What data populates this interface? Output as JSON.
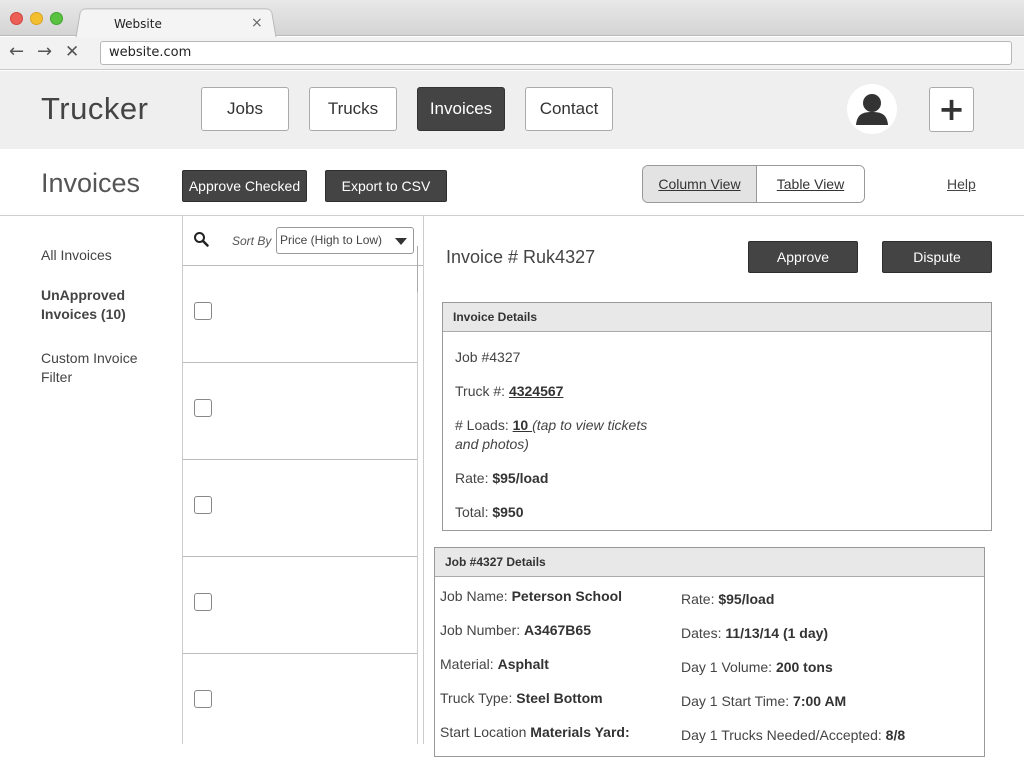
{
  "browser": {
    "tab_title": "Website",
    "tab_close": "×",
    "url": "website.com",
    "back_icon": "←",
    "forward_icon": "→",
    "stop_icon": "✕"
  },
  "app": {
    "logo": "Trucker",
    "nav": [
      "Jobs",
      "Trucks",
      "Invoices",
      "Contact"
    ],
    "active_nav": "Invoices",
    "plus": "+"
  },
  "toolbar": {
    "title": "Invoices",
    "approve_checked": "Approve Checked",
    "export_csv": "Export to CSV",
    "column_view": "Column View",
    "table_view": "Table View",
    "help": "Help"
  },
  "sidebar": {
    "items": [
      "All Invoices",
      "UnApproved Invoices (10)",
      "Custom Invoice Filter"
    ]
  },
  "list": {
    "sort_label": "Sort By",
    "sort_value": "Price (High to Low)",
    "rows": 5
  },
  "invoice": {
    "title": "Invoice # Ruk4327",
    "approve": "Approve",
    "dispute": "Dispute",
    "details_header": "Invoice Details",
    "job": "Job #4327",
    "truck_label": "Truck #: ",
    "truck_value": "4324567",
    "loads_label": "# Loads: ",
    "loads_value": "10 ",
    "loads_note_1": "(tap to view tickets",
    "loads_note_2": "and photos)",
    "rate_label": "Rate: ",
    "rate_value": "$95/load",
    "total_label": "Total: ",
    "total_value": "$950"
  },
  "job": {
    "header": "Job #4327 Details",
    "left": [
      {
        "label": "Job Name: ",
        "value": "Peterson School"
      },
      {
        "label": "Job Number: ",
        "value": "A3467B65"
      },
      {
        "label": "Material: ",
        "value": "Asphalt"
      },
      {
        "label": "Truck Type: ",
        "value": "Steel Bottom"
      },
      {
        "label": "Start Location ",
        "value": "Materials Yard:"
      }
    ],
    "right": [
      {
        "label": "Rate: ",
        "value": "$95/load"
      },
      {
        "label": "Dates: ",
        "value": "11/13/14 (1 day)"
      },
      {
        "label": "Day 1 Volume: ",
        "value": "200 tons"
      },
      {
        "label": "Day 1 Start Time: ",
        "value": "7:00 AM"
      },
      {
        "label": "Day 1 Trucks Needed/Accepted: ",
        "value": "8/8"
      }
    ]
  }
}
